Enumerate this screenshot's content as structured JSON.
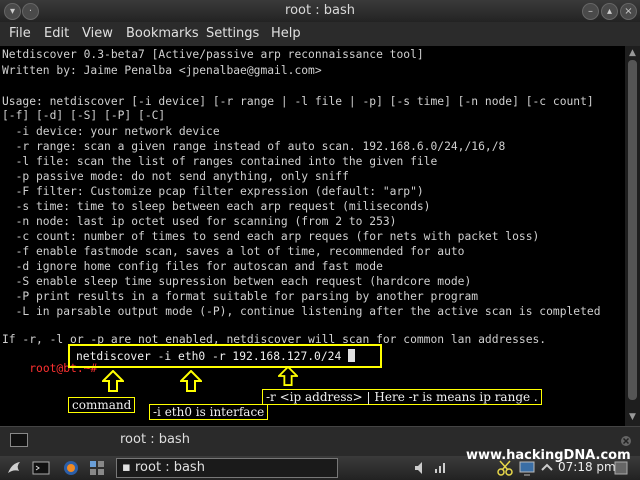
{
  "window": {
    "title": "root : bash"
  },
  "menu": [
    "File",
    "Edit",
    "View",
    "Bookmarks",
    "Settings",
    "Help"
  ],
  "terminal_lines": [
    "Netdiscover 0.3-beta7 [Active/passive arp reconnaissance tool]",
    "Written by: Jaime Penalba <jpenalbae@gmail.com>",
    "",
    "Usage: netdiscover [-i device] [-r range | -l file | -p] [-s time] [-n node] [-c count]",
    "[-f] [-d] [-S] [-P] [-C]",
    "  -i device: your network device",
    "  -r range: scan a given range instead of auto scan. 192.168.6.0/24,/16,/8",
    "  -l file: scan the list of ranges contained into the given file",
    "  -p passive mode: do not send anything, only sniff",
    "  -F filter: Customize pcap filter expression (default: \"arp\")",
    "  -s time: time to sleep between each arp request (miliseconds)",
    "  -n node: last ip octet used for scanning (from 2 to 253)",
    "  -c count: number of times to send each arp reques (for nets with packet loss)",
    "  -f enable fastmode scan, saves a lot of time, recommended for auto",
    "  -d ignore home config files for autoscan and fast mode",
    "  -S enable sleep time supression betwen each request (hardcore mode)",
    "  -P print results in a format suitable for parsing by another program",
    "  -L in parsable output mode (-P), continue listening after the active scan is completed",
    "",
    "If -r, -l or -p are not enabled, netdiscover will scan for common lan addresses."
  ],
  "prompt": {
    "user": "root@bt",
    "sep": ":~#",
    "command": "netdiscover -i eth0 -r 192.168.127.0/24"
  },
  "annotations": {
    "command": "command",
    "interface": "-i eth0 is interface",
    "range": "-r <ip address> | Here -r is means ip range ."
  },
  "tab": {
    "label": "root : bash"
  },
  "taskbar": {
    "window_label": "root : bash",
    "clock": "07:18 pm"
  },
  "watermark": "www.hackingDNA.com",
  "colors": {
    "highlight": "#ffff00",
    "prompt": "#ff3030"
  }
}
